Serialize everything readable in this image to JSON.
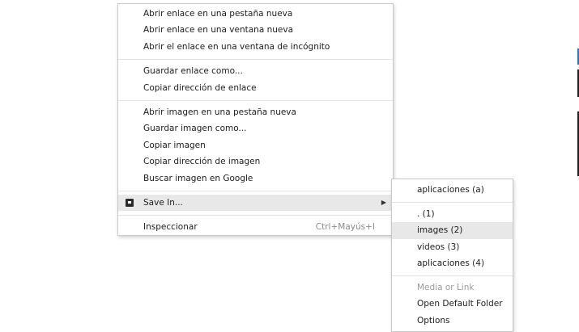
{
  "main_menu": {
    "group1": [
      "Abrir enlace en una pestaña nueva",
      "Abrir enlace en una ventana nueva",
      "Abrir el enlace en una ventana de incógnito"
    ],
    "group2": [
      "Guardar enlace como...",
      "Copiar dirección de enlace"
    ],
    "group3": [
      "Abrir imagen en una pestaña nueva",
      "Guardar imagen como...",
      "Copiar imagen",
      "Copiar dirección de imagen",
      "Buscar imagen en Google"
    ],
    "save_in": {
      "label": "Save In...",
      "icon": "save-in-icon",
      "arrow": "▶"
    },
    "inspect": {
      "label": "Inspeccionar",
      "shortcut": "Ctrl+Mayús+I"
    }
  },
  "submenu": {
    "top_item": "aplicaciones (a)",
    "items": [
      ". (1)",
      "images (2)",
      "videos (3)",
      "aplicaciones (4)"
    ],
    "highlighted_index": 1,
    "bottom": {
      "disabled_label": "Media or Link",
      "open_default": "Open Default Folder",
      "options": "Options"
    }
  },
  "colors": {
    "highlight": "#e8e8e8",
    "disabled_text": "#9a9a9a",
    "shortcut_text": "#8a8a8a"
  }
}
